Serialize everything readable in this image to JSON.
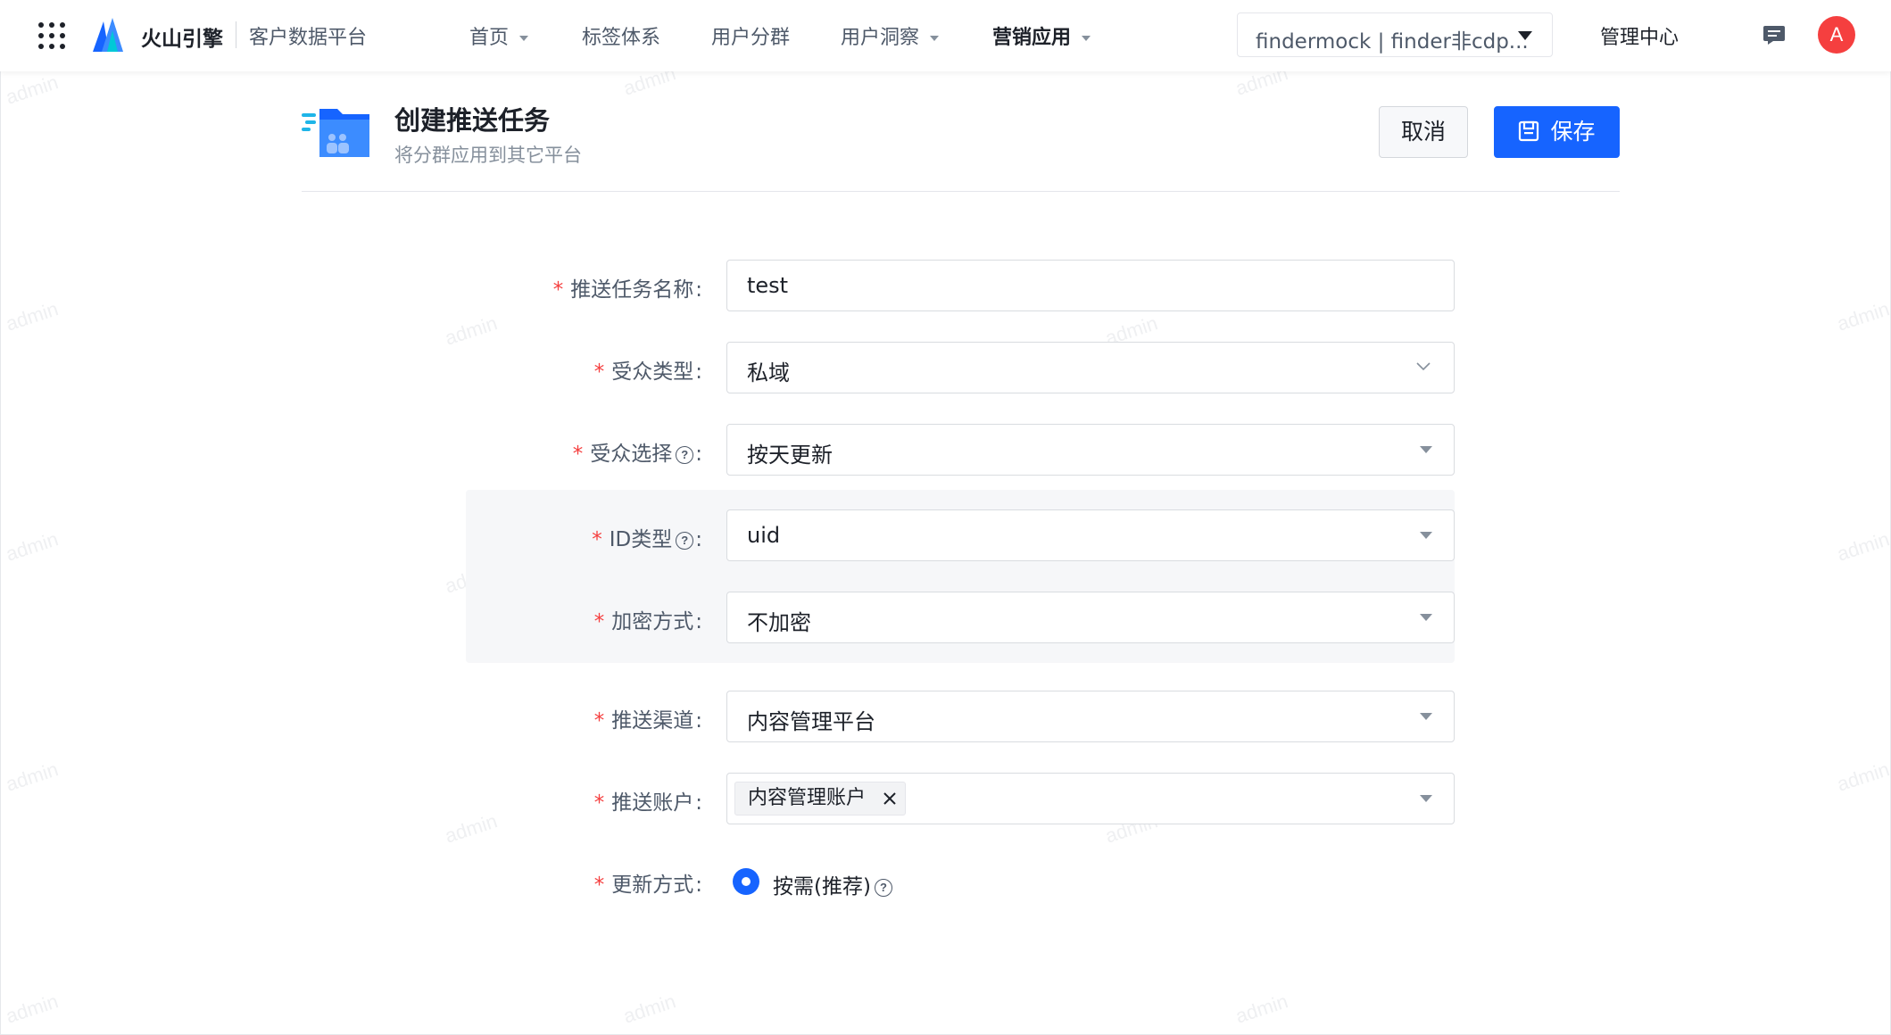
{
  "nav": {
    "brand": "火山引擎",
    "product": "客户数据平台",
    "items": [
      {
        "label": "首页"
      },
      {
        "label": "标签体系"
      },
      {
        "label": "用户分群"
      },
      {
        "label": "用户洞察"
      },
      {
        "label": "营销应用"
      }
    ],
    "project_selector": "findermock | finder非cdp...",
    "admin_center": "管理中心",
    "avatar_initial": "A"
  },
  "header": {
    "title": "创建推送任务",
    "subtitle": "将分群应用到其它平台",
    "cancel_label": "取消",
    "save_label": "保存"
  },
  "form": {
    "task_name": {
      "label": "推送任务名称",
      "value": "test"
    },
    "audience_type": {
      "label": "受众类型",
      "value": "私域"
    },
    "audience_select": {
      "label": "受众选择",
      "value": "按天更新"
    },
    "id_type": {
      "label": "ID类型",
      "value": "uid"
    },
    "encryption": {
      "label": "加密方式",
      "value": "不加密"
    },
    "channel": {
      "label": "推送渠道",
      "value": "内容管理平台"
    },
    "account": {
      "label": "推送账户",
      "tag": "内容管理账户"
    },
    "update_mode": {
      "label": "更新方式",
      "option": "按需(推荐)"
    }
  },
  "watermark": "admin",
  "colors": {
    "primary": "#1664ff",
    "required": "#f53f3f",
    "avatar": "#f53f3f"
  }
}
